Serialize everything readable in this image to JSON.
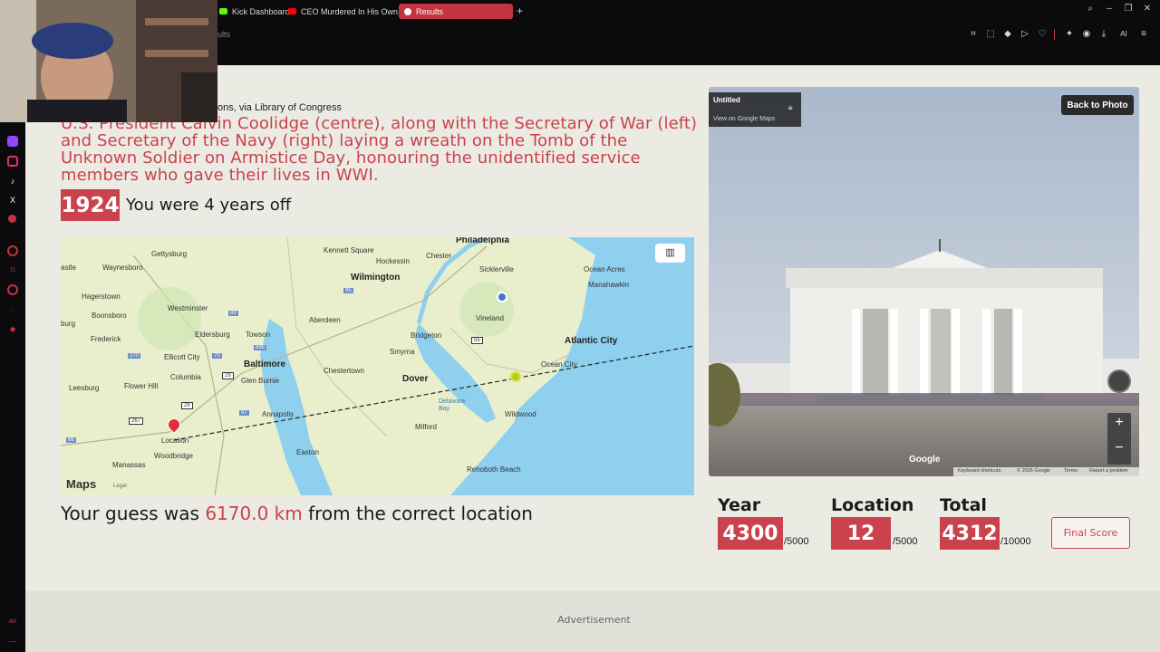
{
  "browser": {
    "tabs": [
      {
        "label": "Kick Dashboard",
        "active": false,
        "fav_color": "#53fc18"
      },
      {
        "label": "CEO Murdered In His Own",
        "active": false,
        "fav_color": "#ff0000"
      },
      {
        "label": "Results",
        "active": true,
        "fav_color": "#ffffff"
      }
    ],
    "new_tab": "+",
    "url_fragment": "ults"
  },
  "result": {
    "credit": "ctions, via Library of Congress",
    "caption": "U.S. President Calvin Coolidge (centre), along with the Secretary of War (left) and Secretary of the Navy (right) laying a wreath on the Tomb of the Unknown Soldier on Armistice Day, honouring the unidentified service members who gave their lives in WWI.",
    "year": "1924",
    "years_off": "You were 4 years off",
    "distance_prefix": "Your guess was ",
    "distance_value": "6170.0 km",
    "distance_suffix": " from the correct location"
  },
  "map": {
    "labels": {
      "philadelphia": "Philadelphia",
      "gettysburg": "Gettysburg",
      "kennett": "Kennett Square",
      "chester": "Chester",
      "hockessin": "Hockessin",
      "sicklerville": "Sicklerville",
      "oceanacres": "Ocean Acres",
      "manahawkin": "Manahawkin",
      "waynesboro": "Waynesboro",
      "wilmington": "Wilmington",
      "castle": "astle",
      "hagerstown": "Hagerstown",
      "westminster": "Westminster",
      "aberdeen": "Aberdeen",
      "vineland": "Vineland",
      "boonsboro": "Boonsboro",
      "frederick": "Frederick",
      "eldersburg": "Eldersburg",
      "towson": "Towson",
      "bridgeton": "Bridgeton",
      "atlanticcity": "Atlantic City",
      "smyrna": "Smyrna",
      "ellicott": "Ellicott City",
      "baltimore": "Baltimore",
      "oceancity": "Ocean City",
      "columbia": "Columbia",
      "chestertown": "Chestertown",
      "glenburnie": "Glen Burnie",
      "dover": "Dover",
      "leesburg": "Leesburg",
      "flowerhill": "Flower Hill",
      "annapolis": "Annapolis",
      "delawarebay": "Delaware Bay",
      "wildwood": "Wildwood",
      "milford": "Milford",
      "location": "Location",
      "easton": "Easton",
      "manassas": "Manassas",
      "woodbridge": "Woodbridge",
      "rehoboth": "Rehoboth Beach",
      "maps_logo": "Maps",
      "legal": "Legal",
      "burg": "burg",
      "r66": "66",
      "r95": "95",
      "r83": "83",
      "r270": "270",
      "r70": "70",
      "r895": "895",
      "r695": "695",
      "r29": "29",
      "r267": "267",
      "r97": "97",
      "r55": "55"
    }
  },
  "streetview": {
    "title": "Untitled",
    "view_link": "View on Google Maps",
    "back_button": "Back to Photo",
    "google": "Google",
    "footer": {
      "shortcuts": "Keyboard shortcuts",
      "copyright": "© 2026 Google",
      "terms": "Terms",
      "report": "Report a problem"
    },
    "zoom_in": "+",
    "zoom_out": "−"
  },
  "scores": {
    "year": {
      "label": "Year",
      "value": "4300",
      "max": "/5000"
    },
    "location": {
      "label": "Location",
      "value": "12",
      "max": "/5000"
    },
    "total": {
      "label": "Total",
      "value": "4312",
      "max": "/10000"
    },
    "final_button": "Final Score"
  },
  "advertisement": "Advertisement",
  "sidebar_bottom": "ax",
  "colors": {
    "accent": "#c9424c",
    "page_bg": "#ecebe3",
    "chrome_bg": "#0b0b0d",
    "map_water": "#8fd0ef",
    "map_land": "#e9efcc"
  },
  "icons": [
    "bookmark-icon",
    "screenshot-icon",
    "pocket-icon",
    "play-icon",
    "heart-icon",
    "extensions-icon",
    "profile-icon",
    "download-icon",
    "ai-icon",
    "menu-icon",
    "search-icon",
    "minimize-icon",
    "restore-icon",
    "close-icon"
  ]
}
